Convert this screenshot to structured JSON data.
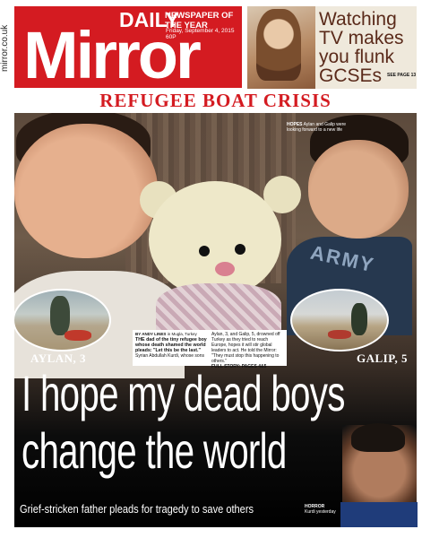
{
  "side_url": "mirror.co.uk",
  "masthead": {
    "daily": "DAILY",
    "mirror": "Mirror",
    "award": "NEWSPAPER OF THE YEAR",
    "date_price": "Friday, September 4, 2015    60P",
    "background_color": "#d41b21"
  },
  "promo": {
    "text": "Watching TV makes you flunk GCSEs",
    "see_page": "SEE PAGE 13"
  },
  "strap": "REFUGEE BOAT CRISIS",
  "photo_caption": {
    "hopes_label": "HOPES",
    "hopes_text": "Aylan and Galip were looking forward to a new life"
  },
  "insets": {
    "left_label": "AYLAN, 3",
    "right_label": "GALIP, 5"
  },
  "story": {
    "byline_name": "BY ANDY LINES",
    "byline_place": "in Mugla, Turkey",
    "lead": "THE dad of the tiny refugee boy whose death shamed the world pleads: \"Let this be the last.\"",
    "lead_tail": "Syrian Abdullah Kurdi, whose sons",
    "col2": "Aylan, 3, and Galip, 5, drowned off Turkey as they tried to reach Europe, hopes it will stir global leaders to act. He told the Mirror: \"They must stop this happening to others.\"",
    "full_story": "FULL STORY: PAGES 4&5"
  },
  "headline": {
    "line1": "I hope my dead boys",
    "line2": "change the world"
  },
  "deck": "Grief-stricken father   pleads for tragedy to save others",
  "father_caption": {
    "label": "HORROR",
    "text": "Kurdi yesterday"
  }
}
